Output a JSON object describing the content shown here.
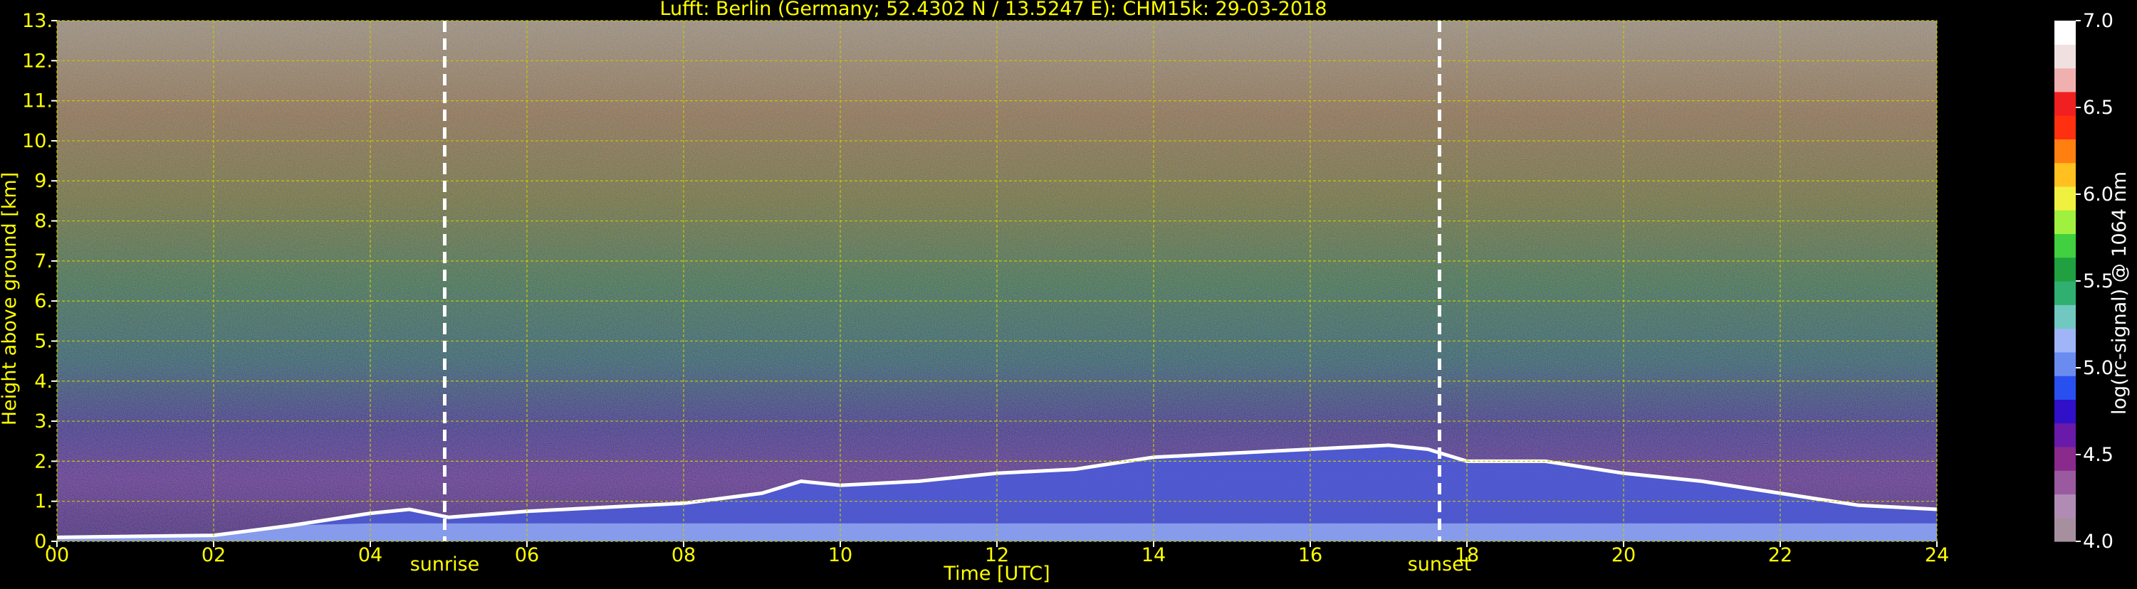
{
  "title": "Lufft: Berlin (Germany; 52.4302 N / 13.5247 E):    CHM15k: 29-03-2018",
  "chart_data": {
    "type": "heatmap",
    "title": "Lufft: Berlin (Germany; 52.4302 N / 13.5247 E):    CHM15k: 29-03-2018",
    "xlabel": "Time [UTC]",
    "ylabel": "Height above ground [km]",
    "xlim": [
      0,
      24
    ],
    "ylim": [
      0,
      13
    ],
    "x_ticks": [
      "00",
      "02",
      "04",
      "06",
      "08",
      "10",
      "12",
      "14",
      "16",
      "18",
      "20",
      "22",
      "24"
    ],
    "y_ticks": [
      "0.",
      "1.",
      "2.",
      "3.",
      "4.",
      "5.",
      "6.",
      "7.",
      "8.",
      "9.",
      "10.",
      "11.",
      "12.",
      "13."
    ],
    "grid": true,
    "grid_color": "#c8c800",
    "text_color": "#ffff00",
    "annotations": [
      {
        "label": "sunrise",
        "x": 4.95
      },
      {
        "label": "sunset",
        "x": 17.65
      }
    ],
    "colorbar": {
      "label": "log(rc-signal) @ 1064 nm",
      "range": [
        4.0,
        7.0
      ],
      "ticks": [
        "4.0",
        "4.5",
        "5.0",
        "5.5",
        "6.0",
        "6.5",
        "7.0"
      ],
      "colors": [
        "#a690a0",
        "#b08cb4",
        "#9a5aa0",
        "#8a2a8c",
        "#6a1aa8",
        "#3010c8",
        "#2850f0",
        "#6a8cf0",
        "#a0b4f8",
        "#70c8c0",
        "#30b070",
        "#20a040",
        "#40d040",
        "#a0f040",
        "#f0f040",
        "#ffc020",
        "#ff8010",
        "#ff3010",
        "#f02020",
        "#f0b0b0",
        "#f0e0e0",
        "#ffffff"
      ]
    },
    "boundary_layer_top_km": {
      "x": [
        0,
        2,
        3,
        4,
        4.5,
        5,
        6,
        7,
        8,
        9,
        9.5,
        10,
        11,
        12,
        13,
        14,
        15,
        16,
        17,
        17.5,
        18,
        19,
        20,
        21,
        22,
        23,
        24
      ],
      "y": [
        0.1,
        0.15,
        0.4,
        0.7,
        0.8,
        0.6,
        0.75,
        0.85,
        0.95,
        1.2,
        1.5,
        1.4,
        1.5,
        1.7,
        1.8,
        2.1,
        2.2,
        2.3,
        2.4,
        2.3,
        2.0,
        2.0,
        1.7,
        1.5,
        1.2,
        0.9,
        0.8
      ]
    }
  }
}
